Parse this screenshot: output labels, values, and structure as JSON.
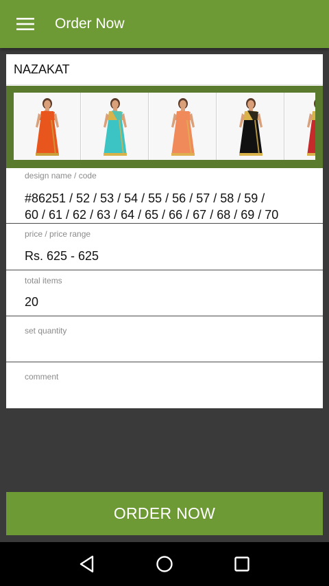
{
  "appbar": {
    "title": "Order Now",
    "menu_icon": "hamburger-menu-icon",
    "color": "#6e9a35"
  },
  "product": {
    "name": "NAZAKAT",
    "thumbnails": [
      {
        "saree_color": "#e8561e",
        "border_color": "#c9a03a",
        "blouse_color": "#e8561e"
      },
      {
        "saree_color": "#3cc3c3",
        "border_color": "#d9b24a",
        "blouse_color": "#d9b24a"
      },
      {
        "saree_color": "#f08a5a",
        "border_color": "#e0b050",
        "blouse_color": "#f08a5a"
      },
      {
        "saree_color": "#111111",
        "border_color": "#d9b24a",
        "blouse_color": "#d9b24a"
      },
      {
        "saree_color": "#c62a2a",
        "border_color": "#d9b24a",
        "blouse_color": "#d9b24a"
      }
    ]
  },
  "fields": {
    "design": {
      "label": "design name / code",
      "line1": "#86251 / 52 / 53 / 54 / 55 / 56 / 57 / 58 / 59 /",
      "line2": "60 / 61 / 62 / 63 / 64 / 65 / 66 / 67 / 68 / 69 / 70"
    },
    "price": {
      "label": "price / price range",
      "value": "Rs. 625 - 625"
    },
    "total": {
      "label": "total items",
      "value": "20"
    },
    "quantity": {
      "label": "set quantity",
      "value": ""
    },
    "comment": {
      "label": "comment",
      "value": ""
    }
  },
  "order_button": {
    "label": "ORDER NOW"
  },
  "navbar": {
    "back_icon": "back-triangle-icon",
    "home_icon": "home-circle-icon",
    "recents_icon": "recents-square-icon"
  }
}
